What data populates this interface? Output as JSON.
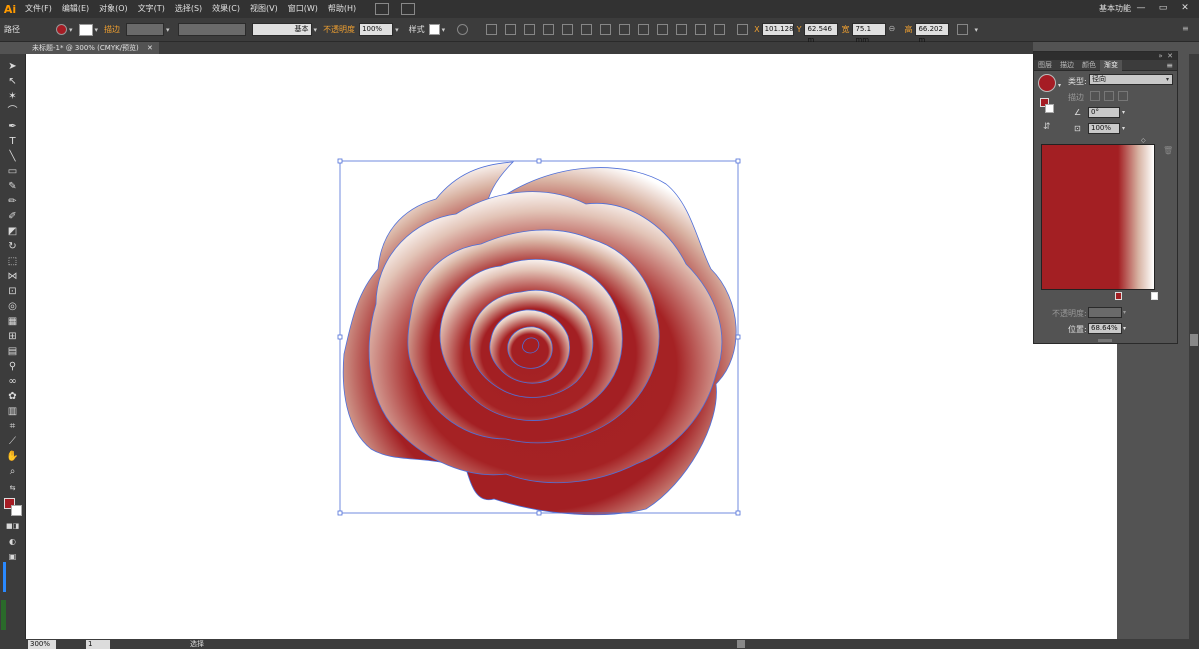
{
  "app": {
    "logo": "Ai",
    "workspace": "基本功能"
  },
  "menu": [
    "文件(F)",
    "编辑(E)",
    "对象(O)",
    "文字(T)",
    "选择(S)",
    "效果(C)",
    "视图(V)",
    "窗口(W)",
    "帮助(H)"
  ],
  "window_controls": {
    "minimize": "—",
    "restore": "▭",
    "close": "✕"
  },
  "controlbar": {
    "selection_label": "路径",
    "stroke_label": "描边",
    "stroke_style": "基本",
    "opacity_label": "不透明度",
    "opacity_value": "100%",
    "style_label": "样式",
    "x_label": "X",
    "x_value": "101.128",
    "y_label": "Y",
    "y_value": "62.546 m",
    "w_label": "宽",
    "w_value": "75.1 mm",
    "h_label": "高",
    "h_value": "66.202 m"
  },
  "document_tab": {
    "title": "未标题-1* @ 300% (CMYK/预览)",
    "close": "✕"
  },
  "status": {
    "zoom": "300%",
    "page": "1",
    "tool_text": "选择"
  },
  "panel": {
    "tabs": [
      "图层",
      "描边",
      "颜色",
      "渐变"
    ],
    "active_tab": "渐变",
    "type_label": "类型:",
    "type_value": "径向",
    "stroke_label": "描边",
    "angle_value": "0°",
    "aspect_value": "100%",
    "opacity_label": "不透明度:",
    "position_label": "位置:",
    "position_value": "68.64%"
  },
  "colors": {
    "fill": "#a51c24",
    "gradient_stop_1": "#a31f23",
    "gradient_stop_2": "#ffffff",
    "selection": "#4f6fd8",
    "accent": "#f0a030"
  }
}
